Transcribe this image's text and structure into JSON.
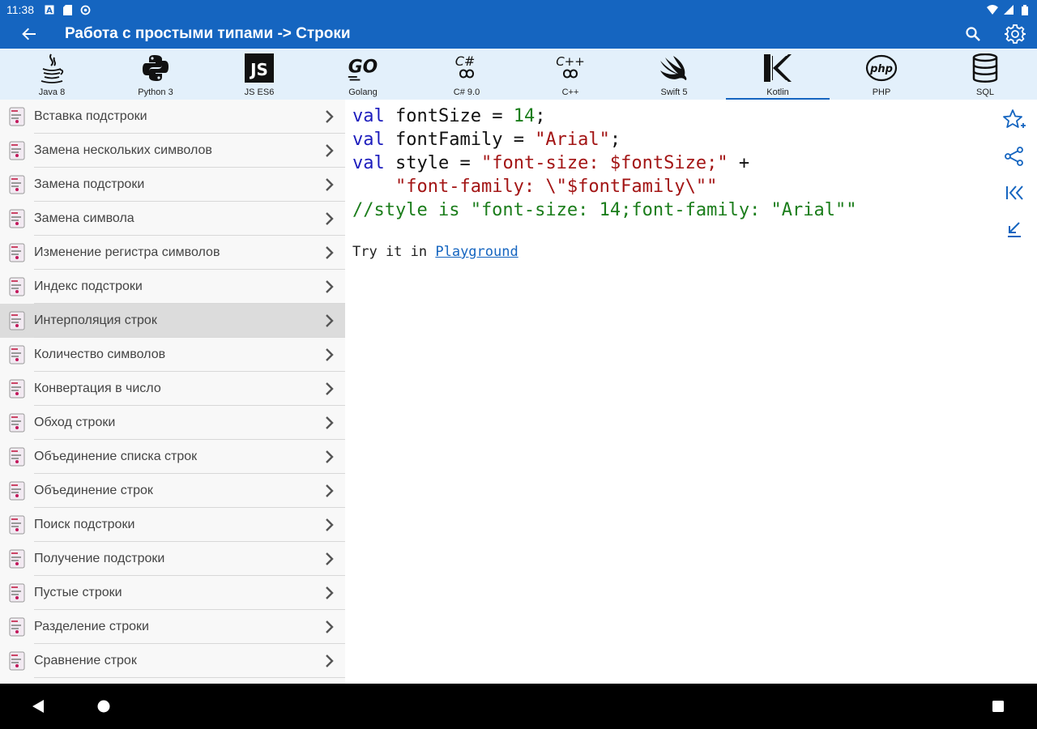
{
  "status": {
    "time": "11:38"
  },
  "appbar": {
    "title": "Работа с простыми типами -> Строки"
  },
  "langs": [
    {
      "name": "Java 8"
    },
    {
      "name": "Python 3"
    },
    {
      "name": "JS ES6"
    },
    {
      "name": "Golang"
    },
    {
      "name": "C# 9.0"
    },
    {
      "name": "C++"
    },
    {
      "name": "Swift 5"
    },
    {
      "name": "Kotlin"
    },
    {
      "name": "PHP"
    },
    {
      "name": "SQL"
    }
  ],
  "active_lang": "Kotlin",
  "sidebar": {
    "items": [
      {
        "label": "Вставка подстроки"
      },
      {
        "label": "Замена нескольких символов"
      },
      {
        "label": "Замена подстроки"
      },
      {
        "label": "Замена символа"
      },
      {
        "label": "Изменение регистра символов"
      },
      {
        "label": "Индекс подстроки"
      },
      {
        "label": "Интерполяция строк"
      },
      {
        "label": "Количество символов"
      },
      {
        "label": "Конвертация в число"
      },
      {
        "label": "Обход строки"
      },
      {
        "label": "Объединение списка строк"
      },
      {
        "label": "Объединение строк"
      },
      {
        "label": "Поиск подстроки"
      },
      {
        "label": "Получение подстроки"
      },
      {
        "label": "Пустые строки"
      },
      {
        "label": "Разделение строки"
      },
      {
        "label": "Сравнение строк"
      }
    ],
    "selected": "Интерполяция строк"
  },
  "code": {
    "lines": [
      [
        {
          "t": "val",
          "c": "kw"
        },
        {
          "t": " fontSize = ",
          "c": ""
        },
        {
          "t": "14",
          "c": "num"
        },
        {
          "t": ";",
          "c": ""
        }
      ],
      [
        {
          "t": "val",
          "c": "kw"
        },
        {
          "t": " fontFamily = ",
          "c": ""
        },
        {
          "t": "\"Arial\"",
          "c": "str"
        },
        {
          "t": ";",
          "c": ""
        }
      ],
      [
        {
          "t": "val",
          "c": "kw"
        },
        {
          "t": " style = ",
          "c": ""
        },
        {
          "t": "\"font-size: $fontSize;\"",
          "c": "str"
        },
        {
          "t": " +",
          "c": ""
        }
      ],
      [
        {
          "t": "    ",
          "c": ""
        },
        {
          "t": "\"font-family: \\\"$fontFamily\\\"\"",
          "c": "str"
        }
      ],
      [
        {
          "t": "//style is \"font-size: 14;font-family: \"Arial\"\"",
          "c": "cm"
        }
      ]
    ]
  },
  "try_it": {
    "prefix": "Try it in ",
    "link": "Playground"
  },
  "colors": {
    "primary": "#1565c0",
    "lang_bar": "#e3f0fb",
    "keyword": "#1d1dbd",
    "string": "#a31515",
    "number": "#1b7d1b",
    "comment": "#1b7d1b"
  }
}
